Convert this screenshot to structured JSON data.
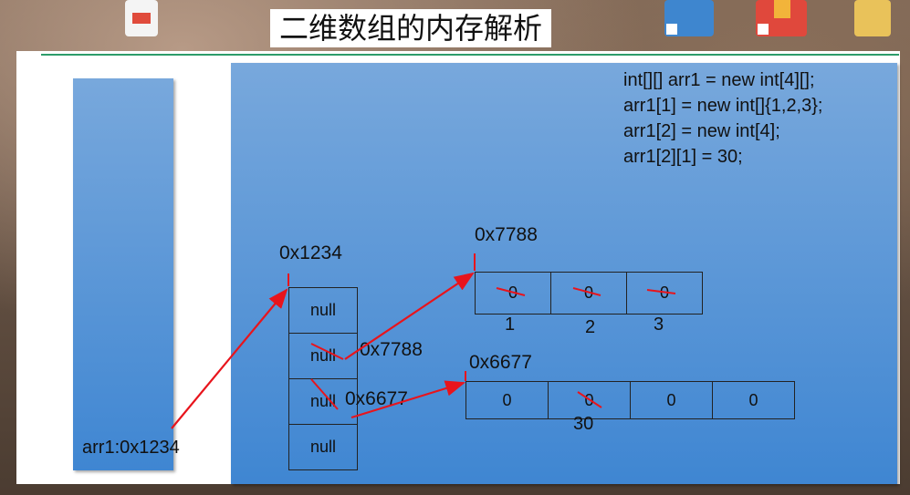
{
  "title": "二维数组的内存解析",
  "code_lines": [
    "int[][] arr1 = new int[4][];",
    "arr1[1] = new int[]{1,2,3};",
    "arr1[2] = new int[4];",
    "arr1[2][1] = 30;"
  ],
  "stack": {
    "variable": "arr1:0x1234"
  },
  "outer_array": {
    "address": "0x1234",
    "cells": [
      "null",
      "null",
      "null",
      "null"
    ]
  },
  "arr1_1": {
    "address": "0x7788",
    "cells": [
      "0",
      "0",
      "0"
    ],
    "new_values": [
      "1",
      "2",
      "3"
    ],
    "pointer_label": "0x7788"
  },
  "arr1_2": {
    "address": "0x6677",
    "cells": [
      "0",
      "0",
      "0",
      "0"
    ],
    "new_value": "30",
    "pointer_label": "0x6677"
  },
  "colors": {
    "arrow": "#e8141c",
    "strike": "#e8141c",
    "box": "#4a90d9"
  }
}
